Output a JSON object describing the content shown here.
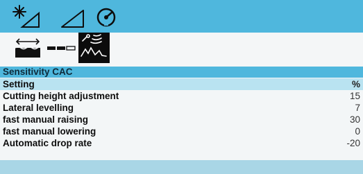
{
  "toolbar": {
    "icons": [
      "sun-slope-icon",
      "slope-angle-icon",
      "gauge-icon"
    ]
  },
  "tabs": [
    {
      "icon": "water-level-icon",
      "active": false
    },
    {
      "icon": "level-bar-icon",
      "active": false
    },
    {
      "icon": "sensitivity-wave-icon",
      "active": true
    }
  ],
  "panel": {
    "title": "Sensitivity CAC",
    "header": {
      "label": "Setting",
      "unit": "%"
    },
    "rows": [
      {
        "label": "Cutting height adjustment",
        "value": "15"
      },
      {
        "label": "Lateral levelling",
        "value": "7"
      },
      {
        "label": "fast manual raising",
        "value": "30"
      },
      {
        "label": "fast manual lowering",
        "value": "0"
      },
      {
        "label": "Automatic drop rate",
        "value": "-20"
      }
    ]
  },
  "colors": {
    "accent": "#4fb7dd",
    "header_row": "#b9e3f1",
    "active_tab": "#0c0c0c"
  }
}
